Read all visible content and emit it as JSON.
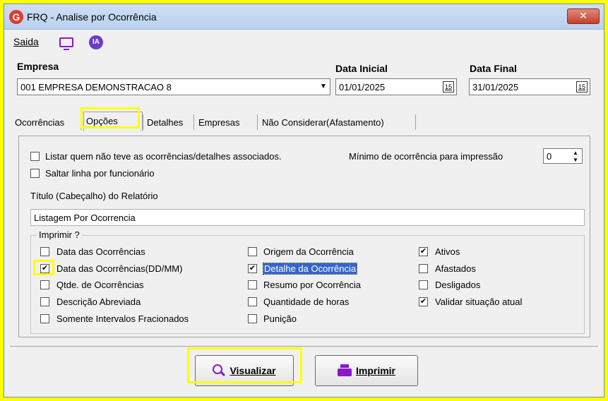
{
  "window": {
    "title": "FRQ - Analise por Ocorrência",
    "logo_letter": "G",
    "close_glyph": "✕"
  },
  "menu": {
    "saida_label": "Saida",
    "ia_label": "IA"
  },
  "empresa": {
    "label": "Empresa",
    "value": "001 EMPRESA DEMONSTRACAO 8"
  },
  "data_inicial": {
    "label": "Data Inicial",
    "value": "01/01/2025",
    "cal_glyph": "15"
  },
  "data_final": {
    "label": "Data Final",
    "value": "31/01/2025",
    "cal_glyph": "15"
  },
  "tabs": [
    "Ocorrências",
    "Opções",
    "Detalhes",
    "Empresas",
    "Não Considerar(Afastamento)"
  ],
  "active_tab": "Opções",
  "options": {
    "listar_label": "Listar quem não teve as ocorrências/detalhes associados.",
    "listar_checked": false,
    "minimo_label": "Mínimo de ocorrência para impressão",
    "minimo_value": "0",
    "saltar_label": "Saltar linha por funcionário",
    "saltar_checked": false,
    "titulo_label": "Título (Cabeçalho) do Relatório",
    "titulo_value": "Listagem Por Ocorrencia"
  },
  "imprimir": {
    "group_label": "Imprimir ?",
    "col1": [
      {
        "label": "Data das Ocorrências",
        "checked": false
      },
      {
        "label": "Data das Ocorrências(DD/MM)",
        "checked": true
      },
      {
        "label": "Qtde. de Ocorrências",
        "checked": false
      },
      {
        "label": "Descrição Abreviada",
        "checked": false
      },
      {
        "label": "Somente Intervalos Fracionados",
        "checked": false
      }
    ],
    "col2": [
      {
        "label": "Origem da Ocorrência",
        "checked": false
      },
      {
        "label": "Detalhe da Ocorrência",
        "checked": true
      },
      {
        "label": "Resumo por Ocorrência",
        "checked": false
      },
      {
        "label": "Quantidade de horas",
        "checked": false
      },
      {
        "label": "Punição",
        "checked": false
      }
    ],
    "col3": [
      {
        "label": "Ativos",
        "checked": true
      },
      {
        "label": "Afastados",
        "checked": false
      },
      {
        "label": "Desligados",
        "checked": false
      },
      {
        "label": "Validar situação atual",
        "checked": true
      }
    ]
  },
  "buttons": {
    "visualizar": "Visualizar",
    "imprimir": "Imprimir"
  },
  "colors": {
    "highlight": "#ffff00",
    "accent": "#8a18c8",
    "selection": "#3366cc"
  }
}
